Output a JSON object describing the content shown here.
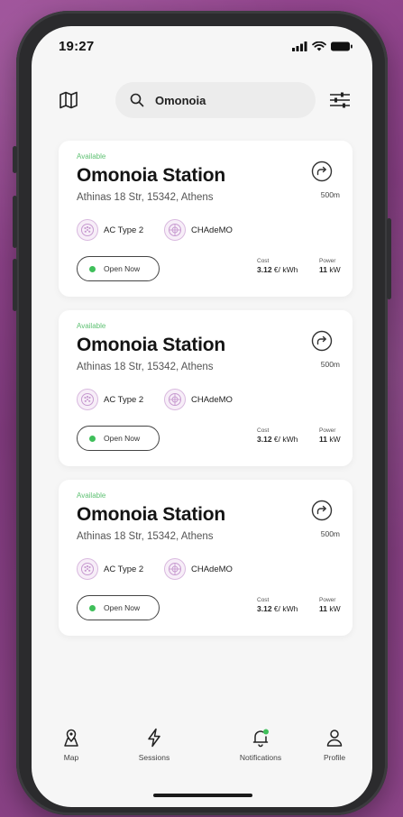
{
  "status_bar": {
    "time": "19:27"
  },
  "search": {
    "query": "Omonoia"
  },
  "stations": [
    {
      "status": "Available",
      "name": "Omonoia Station",
      "address": "Athinas 18 Str, 15342, Athens",
      "distance": "500m",
      "connectors": [
        "AC Type 2",
        "CHAdeMO"
      ],
      "open_label": "Open Now",
      "cost_label": "Cost",
      "cost_value": "3.12",
      "cost_unit": " €/ kWh",
      "power_label": "Power",
      "power_value": "11",
      "power_unit": " kW"
    },
    {
      "status": "Available",
      "name": "Omonoia Station",
      "address": "Athinas 18 Str, 15342, Athens",
      "distance": "500m",
      "connectors": [
        "AC Type 2",
        "CHAdeMO"
      ],
      "open_label": "Open Now",
      "cost_label": "Cost",
      "cost_value": "3.12",
      "cost_unit": " €/ kWh",
      "power_label": "Power",
      "power_value": "11",
      "power_unit": " kW"
    },
    {
      "status": "Available",
      "name": "Omonoia Station",
      "address": "Athinas 18 Str, 15342, Athens",
      "distance": "500m",
      "connectors": [
        "AC Type 2",
        "CHAdeMO"
      ],
      "open_label": "Open Now",
      "cost_label": "Cost",
      "cost_value": "3.12",
      "cost_unit": " €/ kWh",
      "power_label": "Power",
      "power_value": "11",
      "power_unit": " kW"
    }
  ],
  "tabbar": {
    "map": "Map",
    "sessions": "Sessions",
    "notifications": "Notifications",
    "profile": "Profile"
  },
  "colors": {
    "background": "#8b3f86",
    "available": "#5fc173",
    "open_dot": "#3fbf5a",
    "connector_accent": "#d9b9df",
    "notification_badge": "#3fbf5a"
  }
}
